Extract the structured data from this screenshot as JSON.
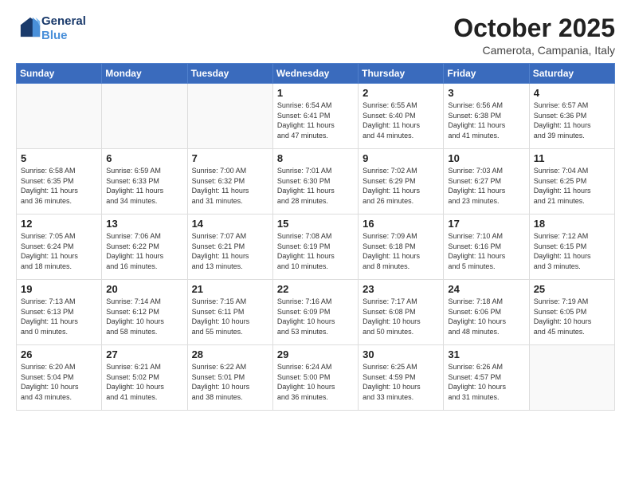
{
  "header": {
    "logo_line1": "General",
    "logo_line2": "Blue",
    "month_title": "October 2025",
    "location": "Camerota, Campania, Italy"
  },
  "weekdays": [
    "Sunday",
    "Monday",
    "Tuesday",
    "Wednesday",
    "Thursday",
    "Friday",
    "Saturday"
  ],
  "weeks": [
    [
      {
        "day": "",
        "info": ""
      },
      {
        "day": "",
        "info": ""
      },
      {
        "day": "",
        "info": ""
      },
      {
        "day": "1",
        "info": "Sunrise: 6:54 AM\nSunset: 6:41 PM\nDaylight: 11 hours\nand 47 minutes."
      },
      {
        "day": "2",
        "info": "Sunrise: 6:55 AM\nSunset: 6:40 PM\nDaylight: 11 hours\nand 44 minutes."
      },
      {
        "day": "3",
        "info": "Sunrise: 6:56 AM\nSunset: 6:38 PM\nDaylight: 11 hours\nand 41 minutes."
      },
      {
        "day": "4",
        "info": "Sunrise: 6:57 AM\nSunset: 6:36 PM\nDaylight: 11 hours\nand 39 minutes."
      }
    ],
    [
      {
        "day": "5",
        "info": "Sunrise: 6:58 AM\nSunset: 6:35 PM\nDaylight: 11 hours\nand 36 minutes."
      },
      {
        "day": "6",
        "info": "Sunrise: 6:59 AM\nSunset: 6:33 PM\nDaylight: 11 hours\nand 34 minutes."
      },
      {
        "day": "7",
        "info": "Sunrise: 7:00 AM\nSunset: 6:32 PM\nDaylight: 11 hours\nand 31 minutes."
      },
      {
        "day": "8",
        "info": "Sunrise: 7:01 AM\nSunset: 6:30 PM\nDaylight: 11 hours\nand 28 minutes."
      },
      {
        "day": "9",
        "info": "Sunrise: 7:02 AM\nSunset: 6:29 PM\nDaylight: 11 hours\nand 26 minutes."
      },
      {
        "day": "10",
        "info": "Sunrise: 7:03 AM\nSunset: 6:27 PM\nDaylight: 11 hours\nand 23 minutes."
      },
      {
        "day": "11",
        "info": "Sunrise: 7:04 AM\nSunset: 6:25 PM\nDaylight: 11 hours\nand 21 minutes."
      }
    ],
    [
      {
        "day": "12",
        "info": "Sunrise: 7:05 AM\nSunset: 6:24 PM\nDaylight: 11 hours\nand 18 minutes."
      },
      {
        "day": "13",
        "info": "Sunrise: 7:06 AM\nSunset: 6:22 PM\nDaylight: 11 hours\nand 16 minutes."
      },
      {
        "day": "14",
        "info": "Sunrise: 7:07 AM\nSunset: 6:21 PM\nDaylight: 11 hours\nand 13 minutes."
      },
      {
        "day": "15",
        "info": "Sunrise: 7:08 AM\nSunset: 6:19 PM\nDaylight: 11 hours\nand 10 minutes."
      },
      {
        "day": "16",
        "info": "Sunrise: 7:09 AM\nSunset: 6:18 PM\nDaylight: 11 hours\nand 8 minutes."
      },
      {
        "day": "17",
        "info": "Sunrise: 7:10 AM\nSunset: 6:16 PM\nDaylight: 11 hours\nand 5 minutes."
      },
      {
        "day": "18",
        "info": "Sunrise: 7:12 AM\nSunset: 6:15 PM\nDaylight: 11 hours\nand 3 minutes."
      }
    ],
    [
      {
        "day": "19",
        "info": "Sunrise: 7:13 AM\nSunset: 6:13 PM\nDaylight: 11 hours\nand 0 minutes."
      },
      {
        "day": "20",
        "info": "Sunrise: 7:14 AM\nSunset: 6:12 PM\nDaylight: 10 hours\nand 58 minutes."
      },
      {
        "day": "21",
        "info": "Sunrise: 7:15 AM\nSunset: 6:11 PM\nDaylight: 10 hours\nand 55 minutes."
      },
      {
        "day": "22",
        "info": "Sunrise: 7:16 AM\nSunset: 6:09 PM\nDaylight: 10 hours\nand 53 minutes."
      },
      {
        "day": "23",
        "info": "Sunrise: 7:17 AM\nSunset: 6:08 PM\nDaylight: 10 hours\nand 50 minutes."
      },
      {
        "day": "24",
        "info": "Sunrise: 7:18 AM\nSunset: 6:06 PM\nDaylight: 10 hours\nand 48 minutes."
      },
      {
        "day": "25",
        "info": "Sunrise: 7:19 AM\nSunset: 6:05 PM\nDaylight: 10 hours\nand 45 minutes."
      }
    ],
    [
      {
        "day": "26",
        "info": "Sunrise: 6:20 AM\nSunset: 5:04 PM\nDaylight: 10 hours\nand 43 minutes."
      },
      {
        "day": "27",
        "info": "Sunrise: 6:21 AM\nSunset: 5:02 PM\nDaylight: 10 hours\nand 41 minutes."
      },
      {
        "day": "28",
        "info": "Sunrise: 6:22 AM\nSunset: 5:01 PM\nDaylight: 10 hours\nand 38 minutes."
      },
      {
        "day": "29",
        "info": "Sunrise: 6:24 AM\nSunset: 5:00 PM\nDaylight: 10 hours\nand 36 minutes."
      },
      {
        "day": "30",
        "info": "Sunrise: 6:25 AM\nSunset: 4:59 PM\nDaylight: 10 hours\nand 33 minutes."
      },
      {
        "day": "31",
        "info": "Sunrise: 6:26 AM\nSunset: 4:57 PM\nDaylight: 10 hours\nand 31 minutes."
      },
      {
        "day": "",
        "info": ""
      }
    ]
  ]
}
